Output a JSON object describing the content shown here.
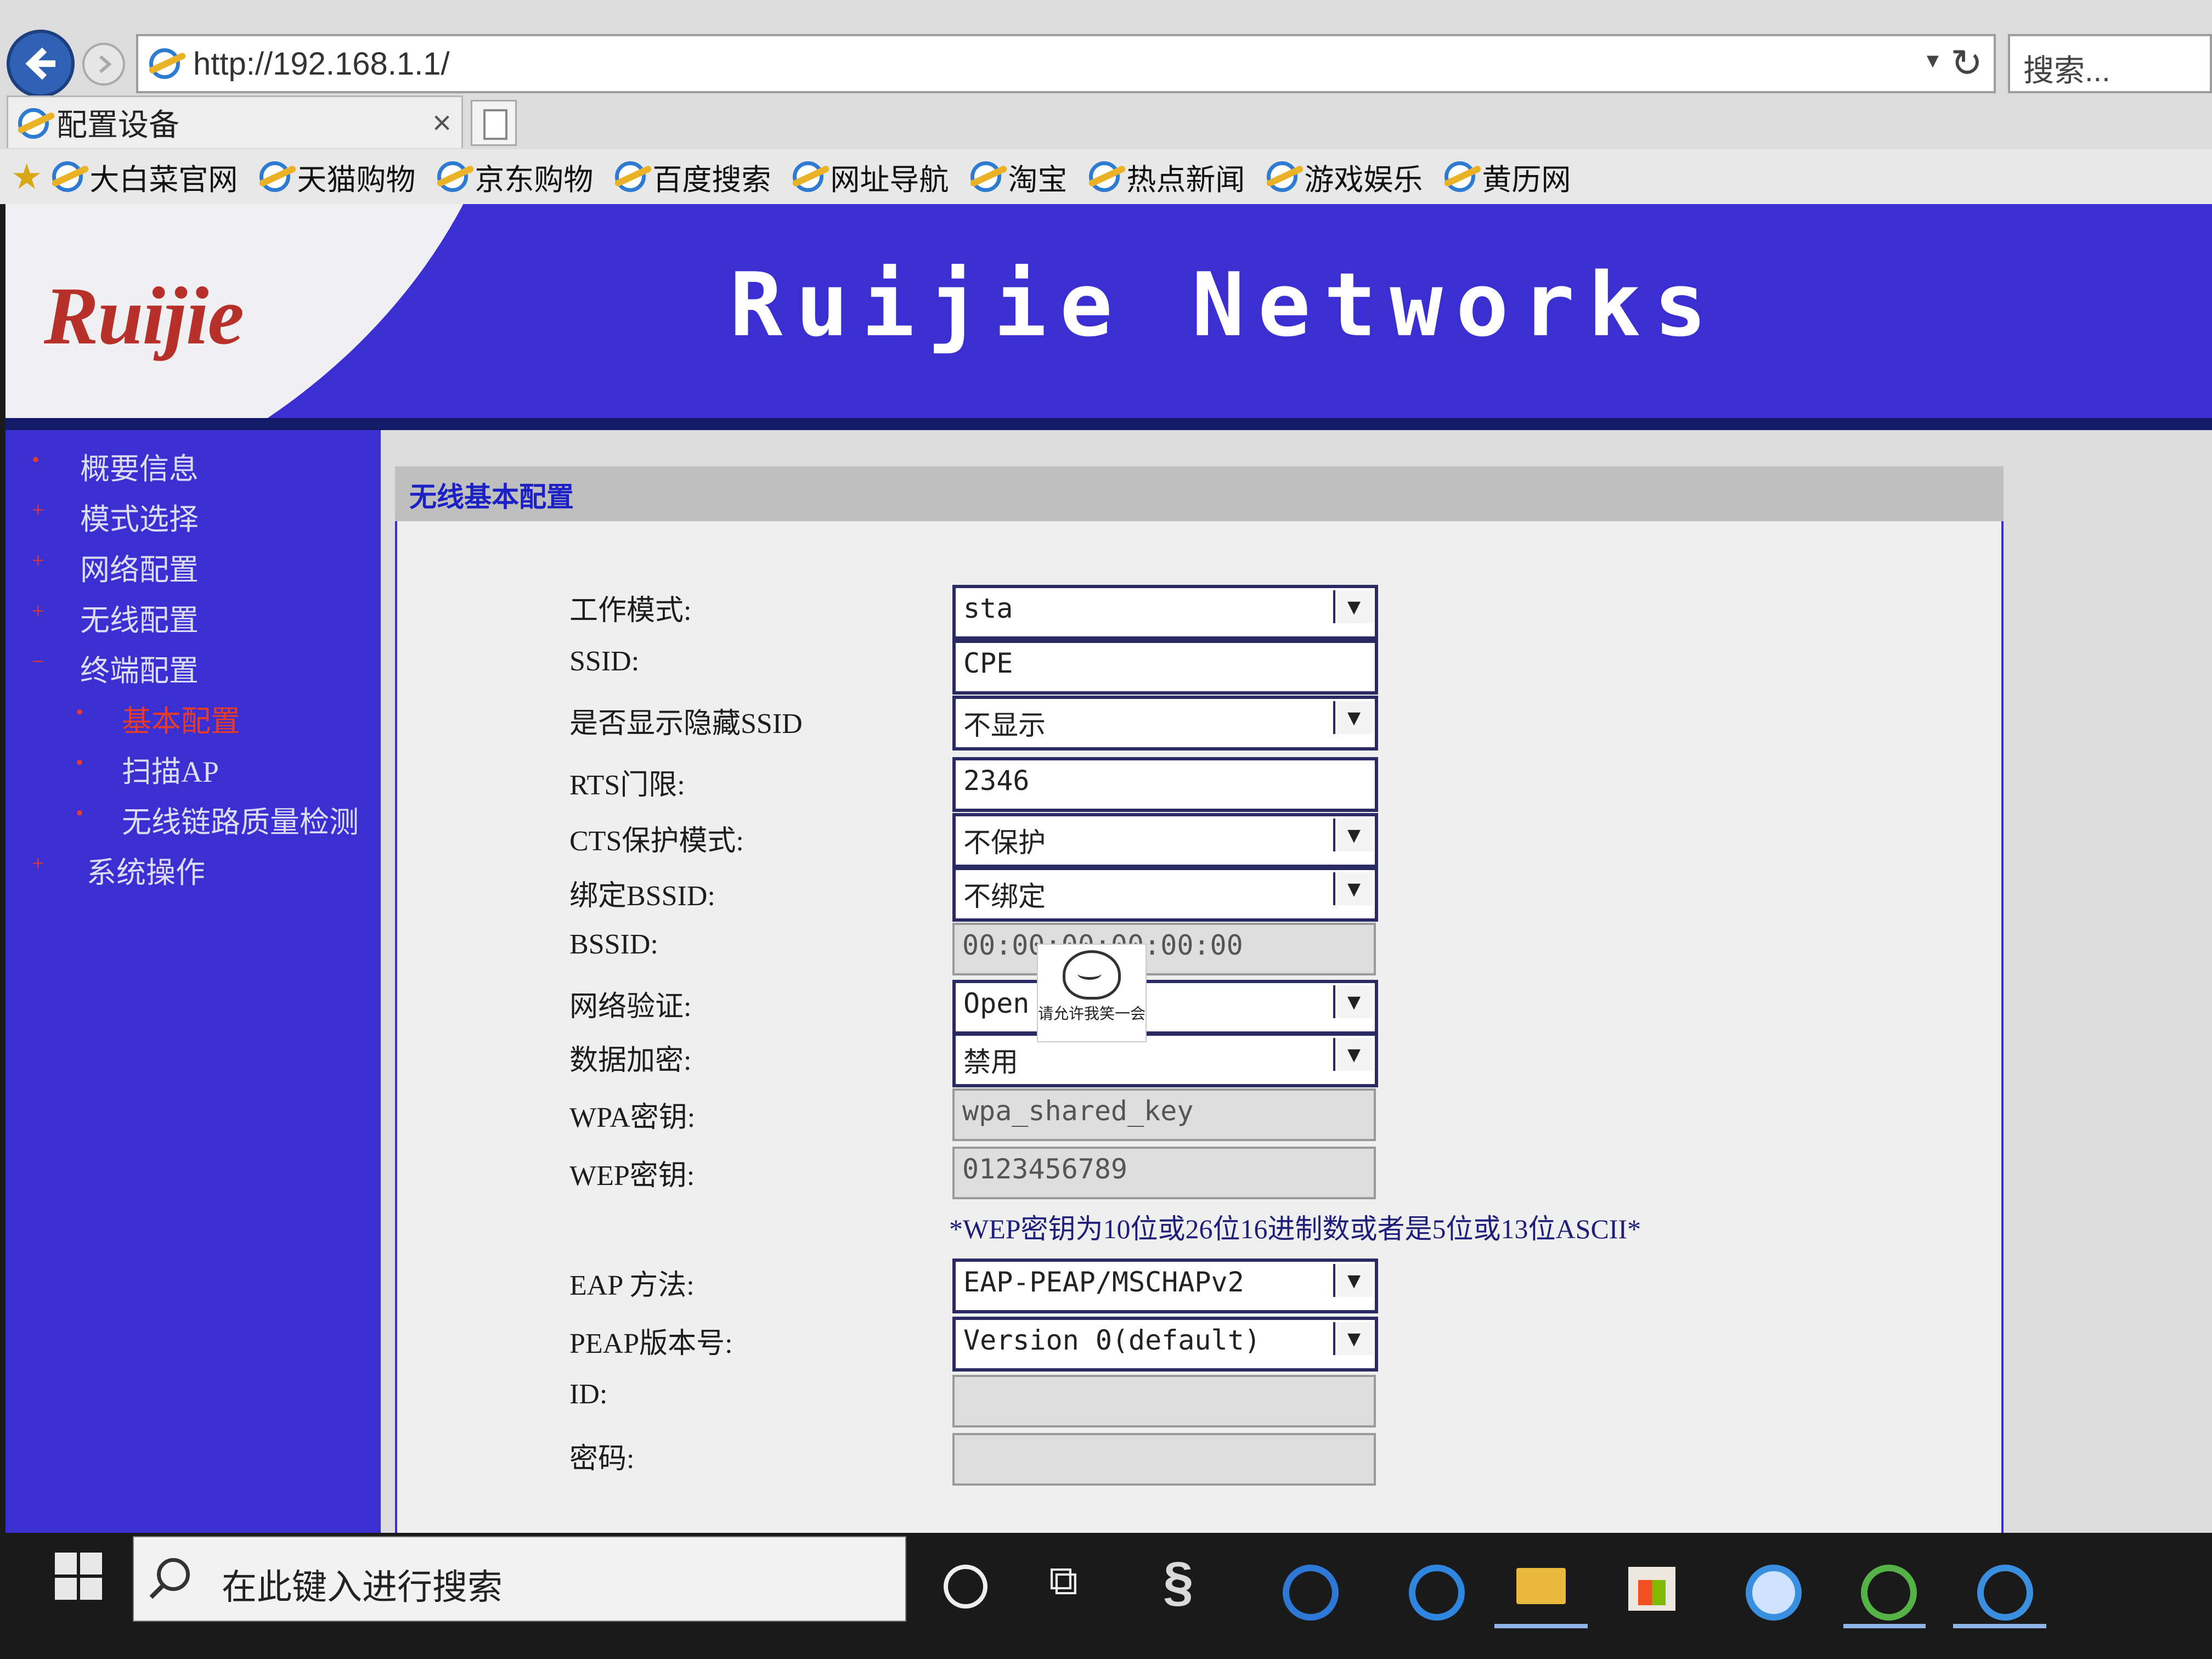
{
  "browser": {
    "url": "http://192.168.1.1/",
    "search_placeholder": "搜索...",
    "tab_title": "配置设备",
    "tab_close": "×",
    "favorites": [
      "大白菜官网",
      "天猫购物",
      "京东购物",
      "百度搜索",
      "网址导航",
      "淘宝",
      "热点新闻",
      "游戏娱乐",
      "黄历网"
    ]
  },
  "banner": {
    "logo_text": "Ruijie",
    "title": "Ruijie Networks"
  },
  "sidebar": {
    "items": [
      {
        "label": "概要信息",
        "bullet": "•"
      },
      {
        "label": "模式选择",
        "bullet": "+"
      },
      {
        "label": "网络配置",
        "bullet": "+"
      },
      {
        "label": "无线配置",
        "bullet": "+"
      },
      {
        "label": "终端配置",
        "bullet": "−"
      },
      {
        "label": "基本配置",
        "bullet": "•"
      },
      {
        "label": "扫描AP",
        "bullet": "•"
      },
      {
        "label": "无线链路质量检测",
        "bullet": "•"
      },
      {
        "label": "系统操作",
        "bullet": "+"
      }
    ],
    "active_item": "基本配置"
  },
  "form": {
    "section_title": "无线基本配置",
    "fields": [
      {
        "label": "工作模式:",
        "value": "sta",
        "type": "select"
      },
      {
        "label": "SSID:",
        "value": "CPE",
        "type": "text"
      },
      {
        "label": "是否显示隐藏SSID",
        "value": "不显示",
        "type": "select"
      },
      {
        "label": "RTS门限:",
        "value": "2346",
        "type": "text"
      },
      {
        "label": "CTS保护模式:",
        "value": "不保护",
        "type": "select"
      },
      {
        "label": "绑定BSSID:",
        "value": "不绑定",
        "type": "select"
      },
      {
        "label": "BSSID:",
        "value": "00:00:00:00:00:00",
        "type": "disabled"
      },
      {
        "label": "网络验证:",
        "value": "Open",
        "type": "select"
      },
      {
        "label": "数据加密:",
        "value": "禁用",
        "type": "select"
      },
      {
        "label": "WPA密钥:",
        "value": "wpa_shared_key",
        "type": "disabled"
      },
      {
        "label": "WEP密钥:",
        "value": "0123456789",
        "type": "disabled"
      },
      {
        "label": "EAP 方法:",
        "value": "EAP-PEAP/MSCHAPv2",
        "type": "select"
      },
      {
        "label": "PEAP版本号:",
        "value": "Version 0(default)",
        "type": "select"
      },
      {
        "label": "ID:",
        "value": "",
        "type": "disabled"
      },
      {
        "label": "密码:",
        "value": "",
        "type": "disabled"
      }
    ],
    "wep_note": "*WEP密钥为10位或26位16进制数或者是5位或13位ASCII*"
  },
  "sticker": {
    "text": "请允许我笑一会"
  },
  "taskbar": {
    "search_placeholder": "在此键入进行搜索"
  },
  "colors": {
    "brand_blue": "#3b2fd2",
    "logo_red": "#b8302a",
    "section_title": "#1b21c4",
    "active_menu": "#e53b2b"
  }
}
